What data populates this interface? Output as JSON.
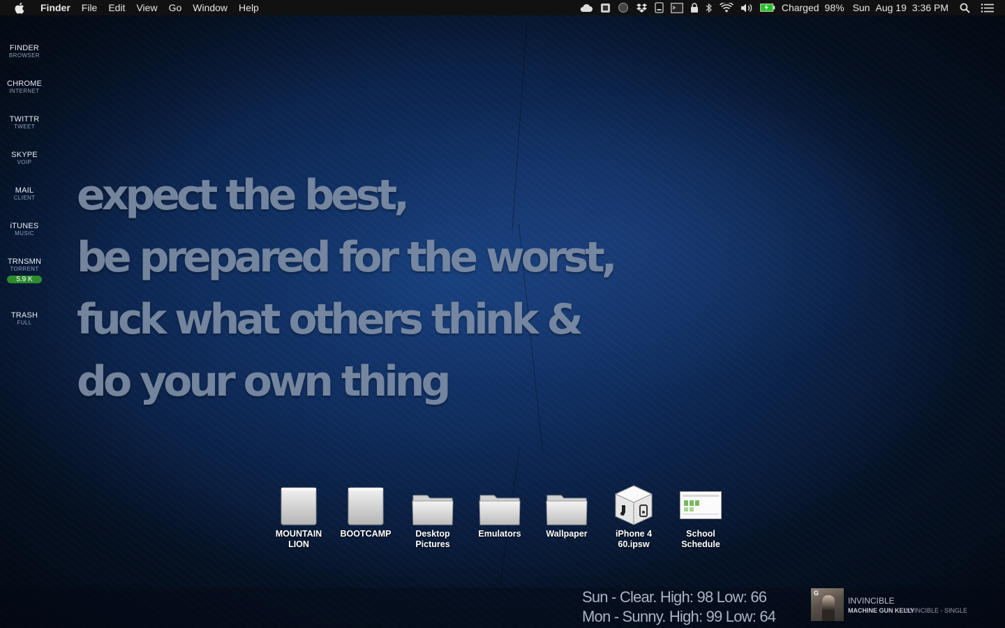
{
  "menubar": {
    "app_name": "Finder",
    "menus": [
      "File",
      "Edit",
      "View",
      "Go",
      "Window",
      "Help"
    ],
    "status": {
      "battery_text": "Charged",
      "battery_percent": "98%",
      "day": "Sun",
      "date": "Aug 19",
      "time": "3:36 PM"
    }
  },
  "sidebar": {
    "items": [
      {
        "title": "FINDER",
        "subtitle": "BROWSER"
      },
      {
        "title": "CHROME",
        "subtitle": "INTERNET"
      },
      {
        "title": "TWITTR",
        "subtitle": "TWEET"
      },
      {
        "title": "SKYPE",
        "subtitle": "VOIP"
      },
      {
        "title": "MAIL",
        "subtitle": "CLIENT"
      },
      {
        "title": "iTUNES",
        "subtitle": "MUSIC"
      },
      {
        "title": "TRNSMN",
        "subtitle": "TORRENT",
        "badge": "5.9 K"
      },
      {
        "title": "TRASH",
        "subtitle": "FULL"
      }
    ]
  },
  "wallpaper": {
    "quote_lines": [
      "expect the best,",
      "be prepared for the worst,",
      "fuck what others think &",
      "do your own thing"
    ]
  },
  "desktop_icons": [
    {
      "label": "MOUNTAIN\nLION",
      "icon": "hard-drive-icon"
    },
    {
      "label": "BOOTCAMP",
      "icon": "hard-drive-icon"
    },
    {
      "label": "Desktop\nPictures",
      "icon": "folder-icon"
    },
    {
      "label": "Emulators",
      "icon": "folder-icon"
    },
    {
      "label": "Wallpaper",
      "icon": "folder-icon"
    },
    {
      "label": "iPhone 4\n60.ipsw",
      "icon": "itunes-file-icon"
    },
    {
      "label": "School\nSchedule",
      "icon": "spreadsheet-thumbnail-icon"
    }
  ],
  "weather": {
    "lines": [
      "Sun - Clear. High: 98 Low: 66",
      "Mon - Sunny. High: 99 Low: 64"
    ]
  },
  "now_playing": {
    "title": "INVINCIBLE",
    "artist": "MACHINE GUN KELLY",
    "album": "INVINCIBLE - SINGLE"
  },
  "colors": {
    "menubar_bg": "#111111",
    "wallpaper_blue": "#173f7c",
    "badge_green": "#2e8b2e",
    "battery_green": "#22c322"
  }
}
